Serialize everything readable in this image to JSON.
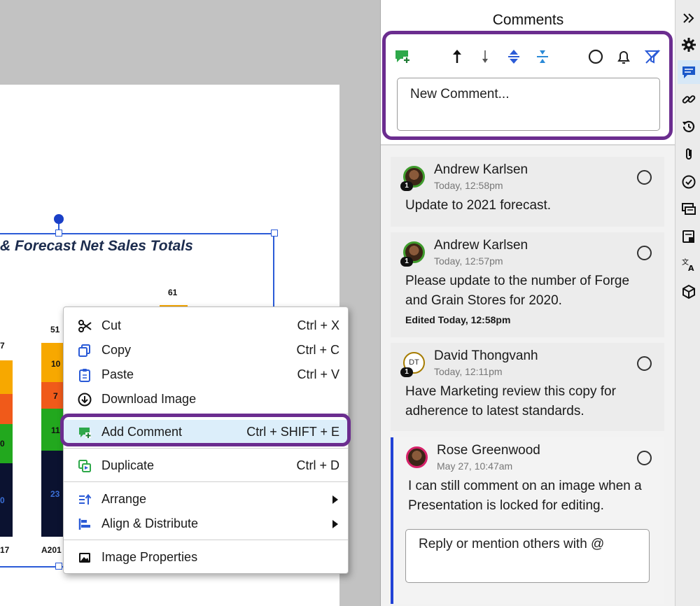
{
  "chart": {
    "title": "& Forecast Net Sales Totals",
    "label_61": "61",
    "label_51": "51",
    "label_7": "7",
    "seg_10": "10",
    "seg_7": "7",
    "seg_11": "11",
    "seg_0": "0",
    "seg_23": "23",
    "seg_cut": "0",
    "x_17": "17",
    "x_a201": "A201"
  },
  "context_menu": {
    "cut": {
      "label": "Cut",
      "shortcut": "Ctrl + X"
    },
    "copy": {
      "label": "Copy",
      "shortcut": "Ctrl + C"
    },
    "paste": {
      "label": "Paste",
      "shortcut": "Ctrl + V"
    },
    "download": {
      "label": "Download Image"
    },
    "add_comment": {
      "label": "Add Comment",
      "shortcut": "Ctrl + SHIFT + E"
    },
    "duplicate": {
      "label": "Duplicate",
      "shortcut": "Ctrl + D"
    },
    "arrange": {
      "label": "Arrange"
    },
    "align": {
      "label": "Align & Distribute"
    },
    "image_props": {
      "label": "Image Properties"
    }
  },
  "comments_panel": {
    "title": "Comments",
    "new_comment_placeholder": "New Comment...",
    "comments": [
      {
        "author": "Andrew Karlsen",
        "time": "Today, 12:58pm",
        "body": "Update to 2021 forecast.",
        "badge": "1"
      },
      {
        "author": "Andrew Karlsen",
        "time": "Today, 12:57pm",
        "body": "Please update to the number of Forge and Grain Stores for 2020.",
        "edited": "Edited Today, 12:58pm",
        "badge": "1"
      },
      {
        "author": "David Thongvanh",
        "initials": "DT",
        "time": "Today, 12:11pm",
        "body": "Have Marketing review this copy for adherence to latest standards.",
        "badge": "1"
      },
      {
        "author": "Rose Greenwood",
        "time": "May 27, 10:47am",
        "body": "I can still comment on an image when a Presentation is locked for editing."
      }
    ],
    "reply_placeholder": "Reply or mention others with @"
  },
  "colors": {
    "highlight": "#6b2d8f",
    "selection": "#2b5bd7",
    "menu_hover": "#dceefa",
    "active_comment_bar": "#2142d6"
  }
}
